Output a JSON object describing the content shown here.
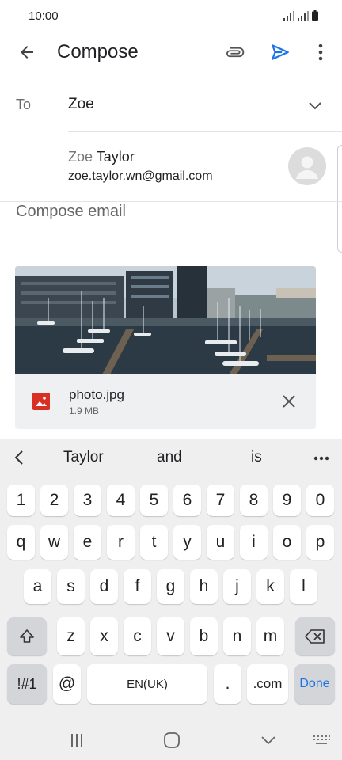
{
  "status_bar": {
    "time": "10:00"
  },
  "app_bar": {
    "title": "Compose"
  },
  "recipient": {
    "to_label": "To",
    "to_value": "Zoe",
    "suggestion": {
      "name_match": "Zoe",
      "name_rest": " Taylor",
      "email": "zoe.taylor.wn@gmail.com"
    }
  },
  "body": {
    "placeholder": "Compose email"
  },
  "attachment": {
    "file_name": "photo.jpg",
    "file_size": "1.9 MB"
  },
  "keyboard": {
    "suggestions": [
      "Taylor",
      "and",
      "is"
    ],
    "row_numbers": [
      "1",
      "2",
      "3",
      "4",
      "5",
      "6",
      "7",
      "8",
      "9",
      "0"
    ],
    "row_q": [
      "q",
      "w",
      "e",
      "r",
      "t",
      "y",
      "u",
      "i",
      "o",
      "p"
    ],
    "row_a": [
      "a",
      "s",
      "d",
      "f",
      "g",
      "h",
      "j",
      "k",
      "l"
    ],
    "row_z": [
      "z",
      "x",
      "c",
      "v",
      "b",
      "n",
      "m"
    ],
    "symbols_label": "!#1",
    "at_label": "@",
    "space_label": "EN(UK)",
    "period_label": ".",
    "dotcom_label": ".com",
    "done_label": "Done"
  },
  "colors": {
    "accent": "#1a73e8",
    "attachment_icon": "#d93025"
  }
}
